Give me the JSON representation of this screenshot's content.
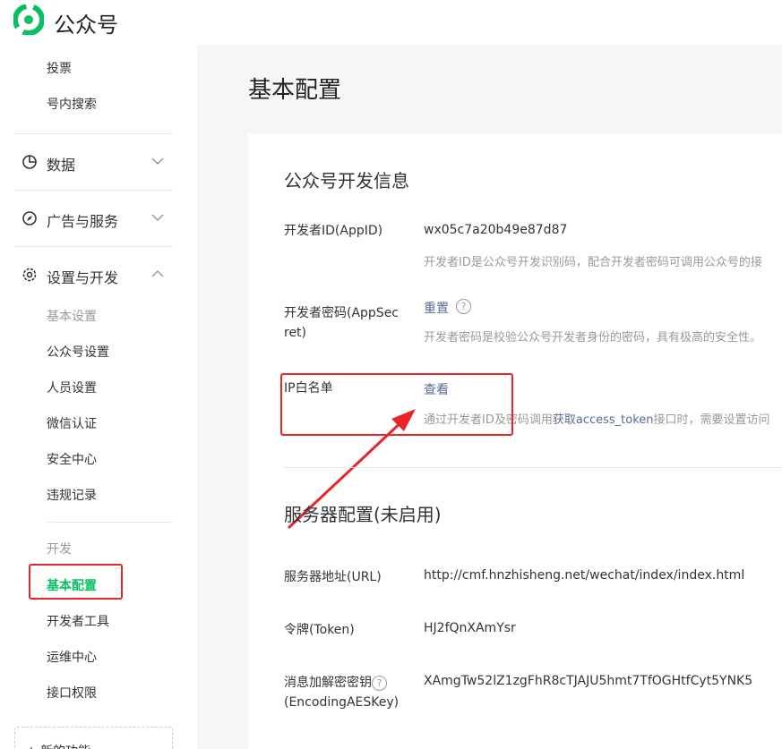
{
  "brand": {
    "name": "公众号"
  },
  "colors": {
    "accent": "#07c160",
    "link": "#576b95",
    "annotation": "#e8262a"
  },
  "sidebar": {
    "items_top": [
      {
        "label": "投票"
      },
      {
        "label": "号内搜索"
      }
    ],
    "groups": [
      {
        "label": "数据",
        "icon": "pie-chart-icon"
      },
      {
        "label": "广告与服务",
        "icon": "compass-icon"
      },
      {
        "label": "设置与开发",
        "icon": "gear-icon"
      }
    ],
    "settings_header": "基本设置",
    "settings_items": [
      {
        "label": "公众号设置"
      },
      {
        "label": "人员设置"
      },
      {
        "label": "微信认证"
      },
      {
        "label": "安全中心"
      },
      {
        "label": "违规记录"
      }
    ],
    "dev_header": "开发",
    "dev_items": [
      {
        "label": "基本配置"
      },
      {
        "label": "开发者工具"
      },
      {
        "label": "运维中心"
      },
      {
        "label": "接口权限"
      }
    ],
    "new_feature": "+ 新的功能"
  },
  "page": {
    "title": "基本配置"
  },
  "dev_info": {
    "title": "公众号开发信息",
    "appid_label": "开发者ID(AppID)",
    "appid_value": "wx05c7a20b49e87d87",
    "appid_desc": "开发者ID是公众号开发识别码，配合开发者密码可调用公众号的接",
    "secret_label_1": "开发者密码(AppSec",
    "secret_label_2": "ret)",
    "secret_reset": "重置",
    "secret_desc": "开发者密码是校验公众号开发者身份的密码，具有极高的安全性。",
    "ip_label": "IP白名单",
    "ip_view": "查看",
    "ip_desc_pre": "通过开发者ID及密码调用",
    "ip_desc_link": "获取access_token",
    "ip_desc_post": "接口时，需要设置访问"
  },
  "server": {
    "title": "服务器配置(未启用)",
    "url_label": "服务器地址(URL)",
    "url_value": "http://cmf.hnzhisheng.net/wechat/index/index.html",
    "token_label": "令牌(Token)",
    "token_value": "HJ2fQnXAmYsr",
    "aes_label_1": "消息加解密密钥",
    "aes_label_2": "(EncodingAESKey)",
    "aes_value": "XAmgTw52lZ1zgFhR8cTJAJU5hmt7TfOGHtfCyt5YNK5"
  }
}
